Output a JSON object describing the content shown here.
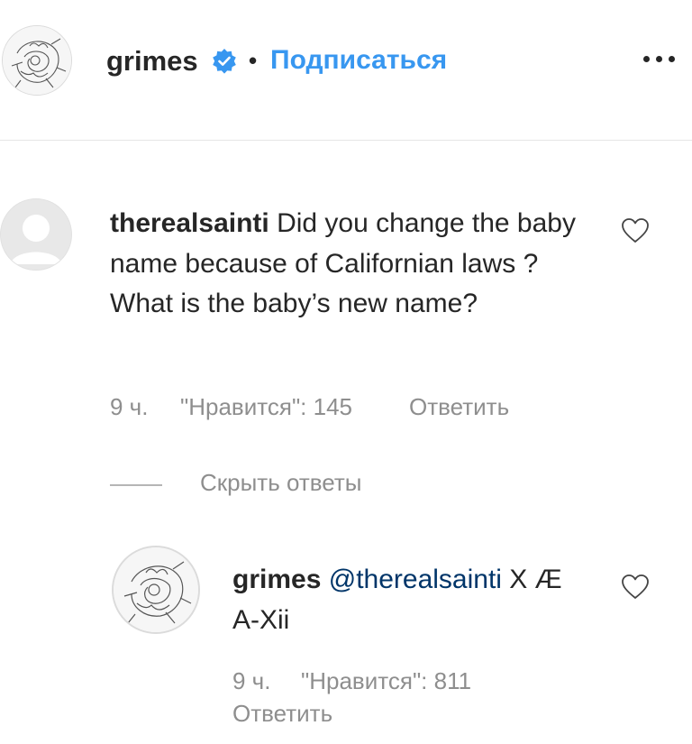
{
  "header": {
    "username": "grimes",
    "separator": "•",
    "follow_label": "Подписаться",
    "more_icon": "more-horizontal-icon",
    "verified_icon": "verified-badge-icon",
    "accent_color": "#3897f0"
  },
  "comment": {
    "username": "therealsainti",
    "text": "Did you change the baby name because of Californian laws ? What is the baby’s new name?",
    "time": "9 ч.",
    "likes_label": "\"Нравится\": 145",
    "reply_label": "Ответить",
    "like_icon": "heart-outline-icon"
  },
  "hide_replies_label": "Скрыть ответы",
  "reply": {
    "username": "grimes",
    "mention": "@therealsainti",
    "text": "X Æ A-Xii",
    "time": "9 ч.",
    "likes_label": "\"Нравится\": 811",
    "reply_label": "Ответить",
    "like_icon": "heart-outline-icon"
  }
}
